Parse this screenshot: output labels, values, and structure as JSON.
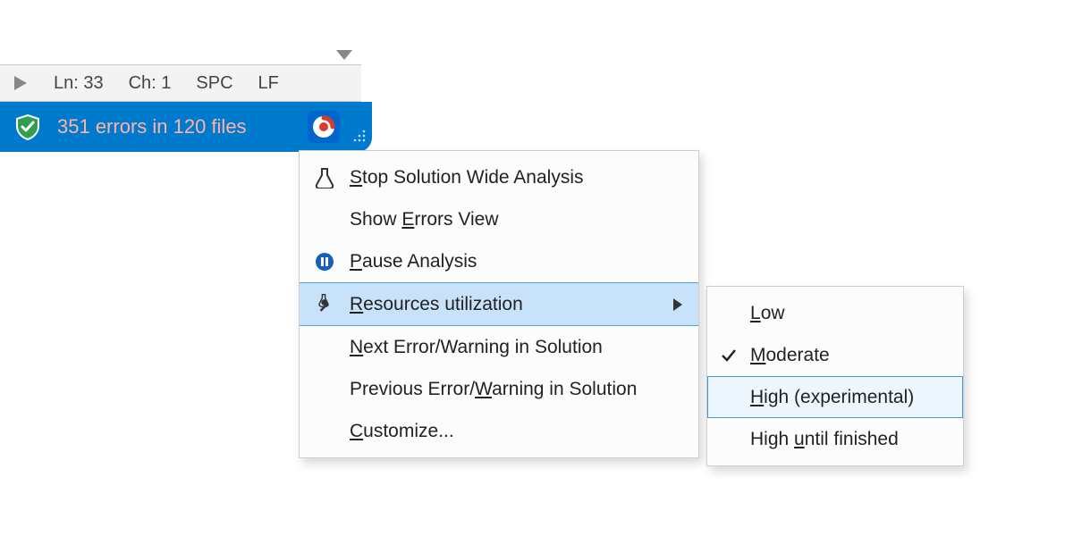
{
  "editor_status": {
    "line": "Ln: 33",
    "char": "Ch: 1",
    "indent": "SPC",
    "line_ending": "LF"
  },
  "error_bar": {
    "text": "351 errors in 120 files"
  },
  "context_menu": {
    "stop": "Stop Solution Wide Analysis",
    "show_errors": "Show Errors View",
    "pause": "Pause Analysis",
    "resources": "Resources utilization",
    "next": "Next Error/Warning in Solution",
    "previous": "Previous Error/Warning in Solution",
    "customize": "Customize..."
  },
  "resources_submenu": {
    "low": "Low",
    "moderate": "Moderate",
    "high_exp": "High (experimental)",
    "high_until": "High until finished"
  }
}
